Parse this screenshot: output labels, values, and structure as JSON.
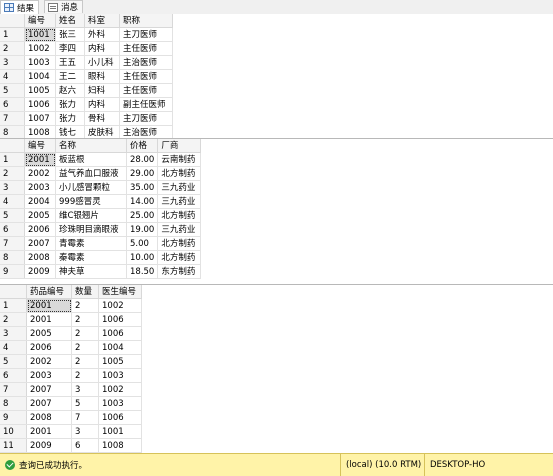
{
  "tabs": [
    {
      "label": "结果",
      "active": true,
      "icon": "grid-icon"
    },
    {
      "label": "消息",
      "active": false,
      "icon": "message-icon"
    }
  ],
  "grid1": {
    "columns": [
      "编号",
      "姓名",
      "科室",
      "职称"
    ],
    "rows": [
      [
        "1",
        "1001",
        "张三",
        "外科",
        "主刀医师"
      ],
      [
        "2",
        "1002",
        "李四",
        "内科",
        "主任医师"
      ],
      [
        "3",
        "1003",
        "王五",
        "小儿科",
        "主治医师"
      ],
      [
        "4",
        "1004",
        "王二",
        "眼科",
        "主任医师"
      ],
      [
        "5",
        "1005",
        "赵六",
        "妇科",
        "主任医师"
      ],
      [
        "6",
        "1006",
        "张力",
        "内科",
        "副主任医师"
      ],
      [
        "7",
        "1007",
        "张力",
        "骨科",
        "主刀医师"
      ],
      [
        "8",
        "1008",
        "钱七",
        "皮肤科",
        "主治医师"
      ]
    ]
  },
  "grid2": {
    "columns": [
      "编号",
      "名称",
      "价格",
      "厂商"
    ],
    "rows": [
      [
        "1",
        "2001",
        "板蓝根",
        "28.00",
        "云南制药"
      ],
      [
        "2",
        "2002",
        "益气养血口服液",
        "29.00",
        "北方制药"
      ],
      [
        "3",
        "2003",
        "小儿感冒颗粒",
        "35.00",
        "三九药业"
      ],
      [
        "4",
        "2004",
        "999感冒灵",
        "14.00",
        "三九药业"
      ],
      [
        "5",
        "2005",
        "维C银翘片",
        "25.00",
        "北方制药"
      ],
      [
        "6",
        "2006",
        "珍珠明目滴眼液",
        "19.00",
        "三九药业"
      ],
      [
        "7",
        "2007",
        "青霉素",
        "5.00",
        "北方制药"
      ],
      [
        "8",
        "2008",
        "秦霉素",
        "10.00",
        "北方制药"
      ],
      [
        "9",
        "2009",
        "神夫草",
        "18.50",
        "东方制药"
      ]
    ]
  },
  "grid3": {
    "columns": [
      "药品编号",
      "数量",
      "医生编号"
    ],
    "rows": [
      [
        "1",
        "2001",
        "2",
        "1002"
      ],
      [
        "2",
        "2001",
        "2",
        "1006"
      ],
      [
        "3",
        "2005",
        "2",
        "1006"
      ],
      [
        "4",
        "2006",
        "2",
        "1004"
      ],
      [
        "5",
        "2002",
        "2",
        "1005"
      ],
      [
        "6",
        "2003",
        "2",
        "1003"
      ],
      [
        "7",
        "2007",
        "3",
        "1002"
      ],
      [
        "8",
        "2007",
        "5",
        "1003"
      ],
      [
        "9",
        "2008",
        "7",
        "1006"
      ],
      [
        "10",
        "2001",
        "3",
        "1001"
      ],
      [
        "11",
        "2009",
        "6",
        "1008"
      ]
    ]
  },
  "status": {
    "message": "查询已成功执行。",
    "server": "(local) (10.0 RTM)",
    "machine": "DESKTOP-HO"
  }
}
